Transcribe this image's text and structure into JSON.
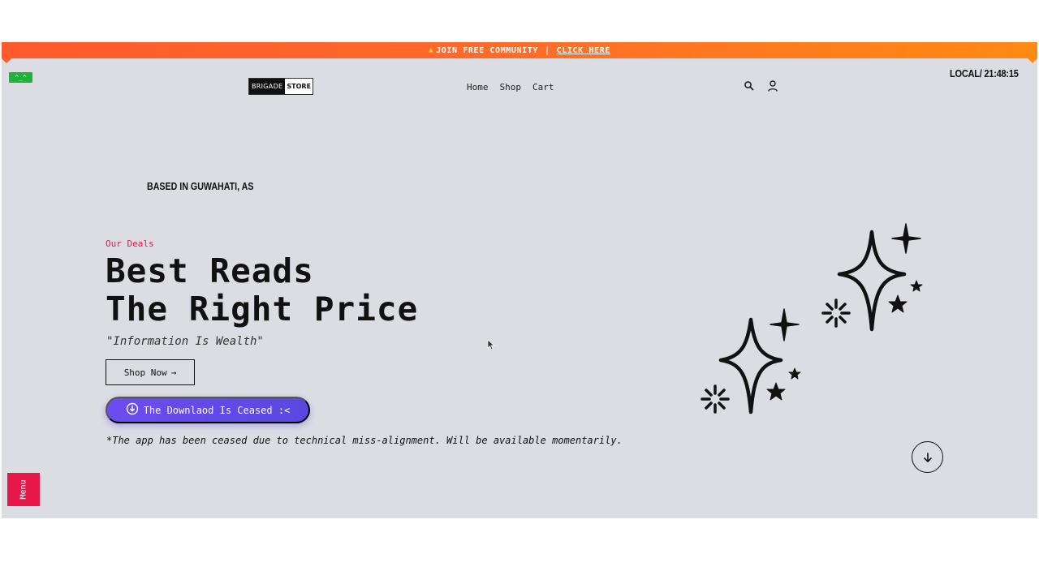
{
  "promo": {
    "flame_icon": "flame-icon",
    "text": "JOIN FREE COMMUNITY",
    "separator": "|",
    "link_label": "CLICK HERE"
  },
  "terminal_badge": "^_^",
  "header": {
    "logo_left": "BRIGADE",
    "logo_right": "STORE",
    "nav": [
      "Home",
      "Shop",
      "Cart"
    ],
    "icons": [
      "search-icon",
      "user-icon"
    ],
    "clock": "LOCAL/ 21:48:15"
  },
  "hero": {
    "location": "BASED IN GUWAHATI, AS",
    "eyebrow": "Our Deals",
    "headline_line1": "Best Reads",
    "headline_line2": "The Right Price",
    "tagline": "\"Information Is Wealth\"",
    "shop_button": "Shop Now",
    "shop_arrow": "→",
    "download_button": "The Downlaod Is Ceased :<",
    "notice": "*The app has been ceased due to technical miss-alignment. Will be available momentarily."
  },
  "menu_tab": "Menu",
  "colors": {
    "accent": "#e8174a",
    "promo_start": "#ff5a2c",
    "promo_end": "#ff8a14",
    "download_button": "#6c4df0",
    "background": "#dcdce3"
  }
}
